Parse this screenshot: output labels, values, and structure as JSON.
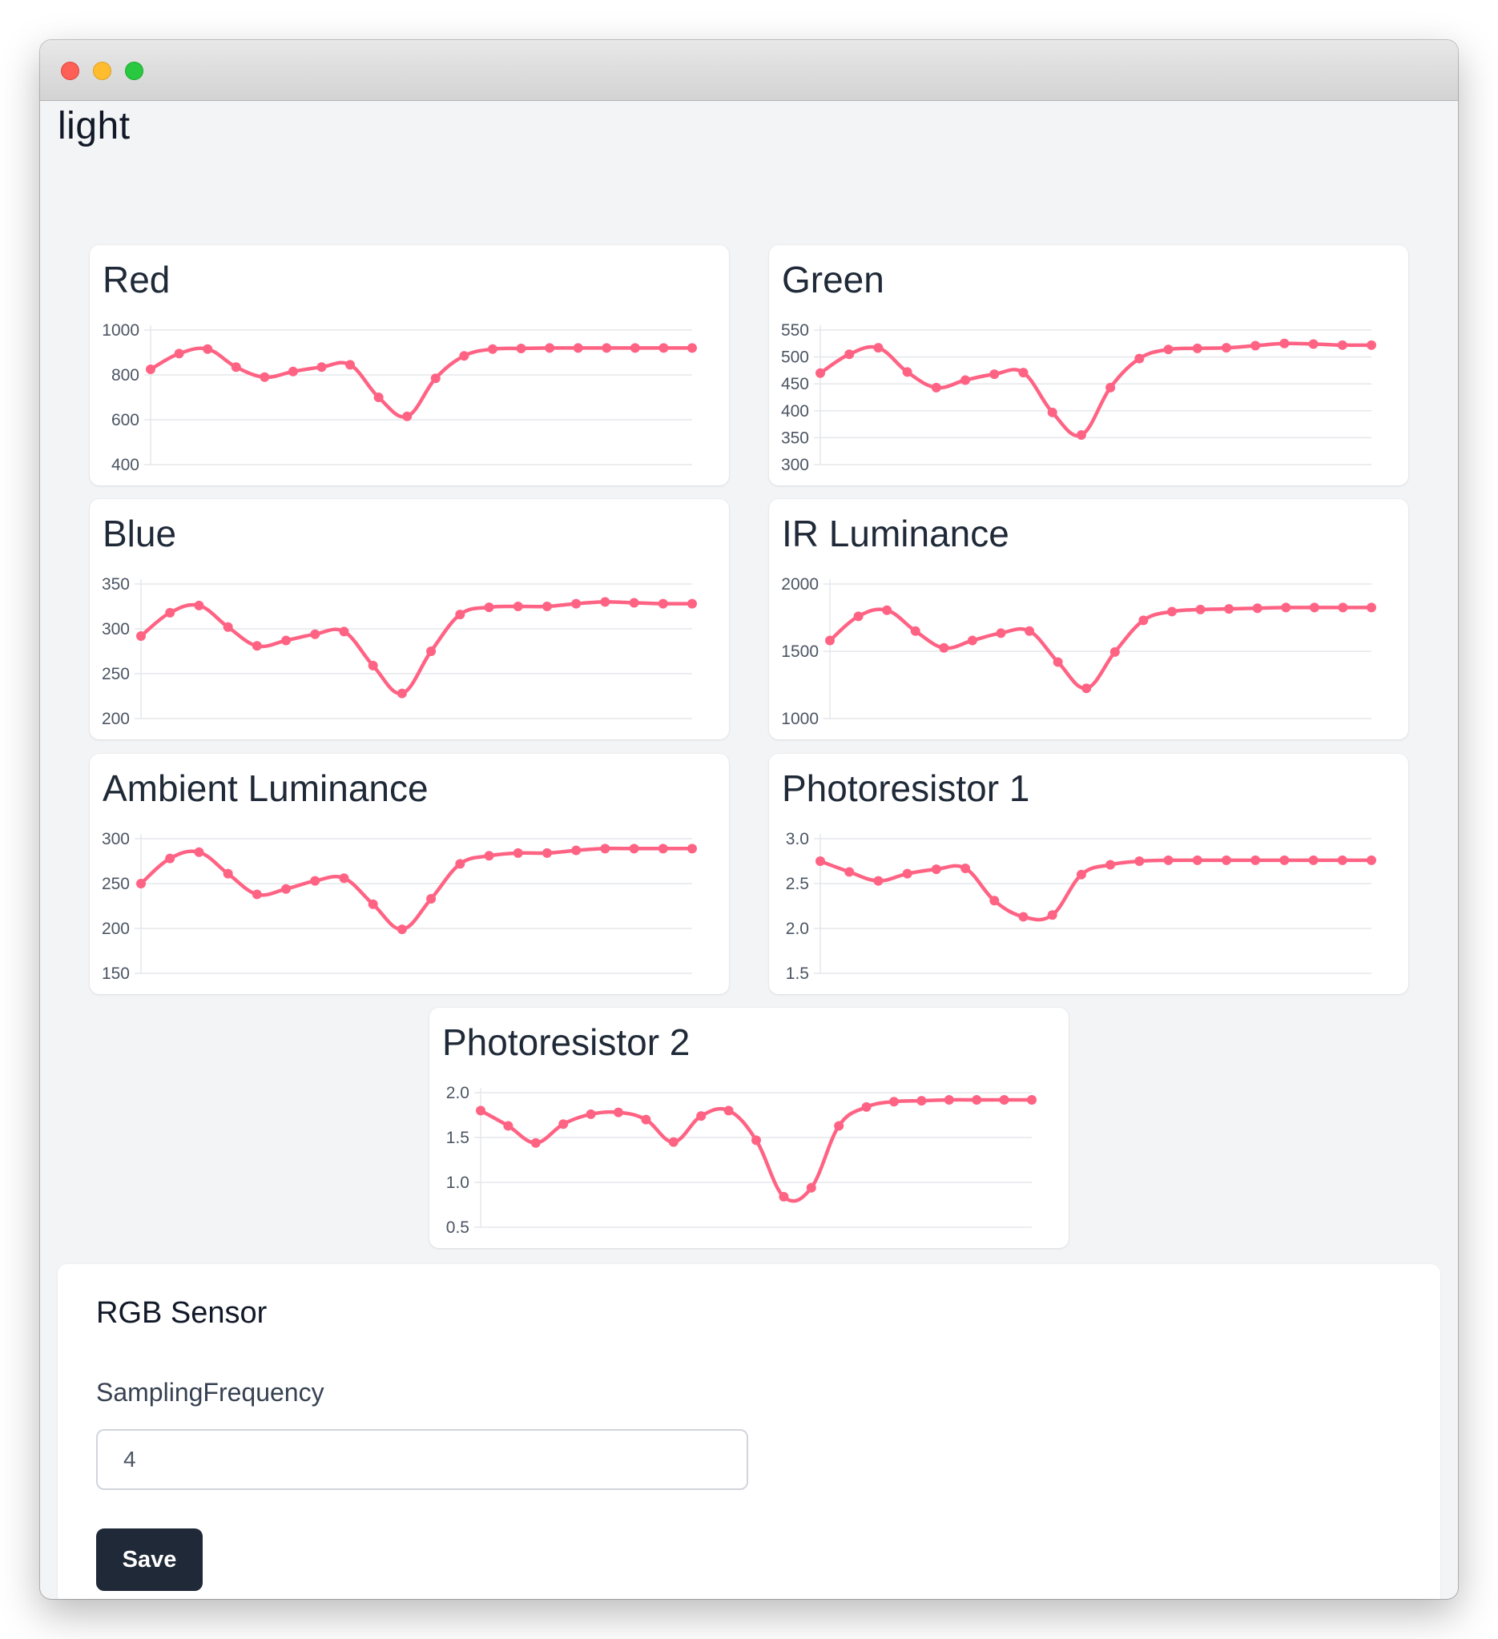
{
  "window": {
    "page_title": "light"
  },
  "line_color": "#ff6384",
  "charts": [
    {
      "id": "red",
      "title": "Red",
      "yticks": [
        "1000",
        "800",
        "600",
        "400"
      ]
    },
    {
      "id": "green",
      "title": "Green",
      "yticks": [
        "550",
        "500",
        "450",
        "400",
        "350",
        "300"
      ]
    },
    {
      "id": "blue",
      "title": "Blue",
      "yticks": [
        "350",
        "300",
        "250",
        "200"
      ]
    },
    {
      "id": "ir",
      "title": "IR Luminance",
      "yticks": [
        "2000",
        "1500",
        "1000"
      ]
    },
    {
      "id": "ambient",
      "title": "Ambient Luminance",
      "yticks": [
        "300",
        "250",
        "200",
        "150"
      ]
    },
    {
      "id": "pr1",
      "title": "Photoresistor 1",
      "yticks": [
        "3.0",
        "2.5",
        "2.0",
        "1.5"
      ]
    },
    {
      "id": "pr2",
      "title": "Photoresistor 2",
      "yticks": [
        "2.0",
        "1.5",
        "1.0",
        "0.5"
      ]
    }
  ],
  "chart_data": [
    {
      "type": "line",
      "title": "Red",
      "ylim": [
        400,
        1000
      ],
      "grid": true,
      "series": [
        {
          "values": [
            825,
            895,
            915,
            835,
            790,
            815,
            835,
            845,
            700,
            615,
            785,
            885,
            915,
            918,
            920,
            920,
            920,
            920,
            920,
            920
          ]
        }
      ]
    },
    {
      "type": "line",
      "title": "Green",
      "ylim": [
        300,
        550
      ],
      "grid": true,
      "series": [
        {
          "values": [
            470,
            505,
            517,
            472,
            443,
            457,
            468,
            471,
            397,
            355,
            443,
            497,
            514,
            516,
            517,
            521,
            525,
            524,
            522,
            522
          ]
        }
      ]
    },
    {
      "type": "line",
      "title": "Blue",
      "ylim": [
        200,
        350
      ],
      "grid": true,
      "series": [
        {
          "values": [
            292,
            318,
            326,
            302,
            281,
            287,
            294,
            297,
            259,
            228,
            275,
            316,
            324,
            325,
            325,
            328,
            330,
            329,
            328,
            328
          ]
        }
      ]
    },
    {
      "type": "line",
      "title": "IR Luminance",
      "ylim": [
        1000,
        2000
      ],
      "grid": true,
      "series": [
        {
          "values": [
            1580,
            1760,
            1805,
            1650,
            1525,
            1580,
            1635,
            1650,
            1420,
            1225,
            1495,
            1730,
            1795,
            1810,
            1815,
            1820,
            1825,
            1825,
            1825,
            1825
          ]
        }
      ]
    },
    {
      "type": "line",
      "title": "Ambient Luminance",
      "ylim": [
        150,
        300
      ],
      "grid": true,
      "series": [
        {
          "values": [
            250,
            278,
            285,
            261,
            238,
            244,
            253,
            256,
            227,
            199,
            233,
            272,
            281,
            284,
            284,
            287,
            289,
            289,
            289,
            289
          ]
        }
      ]
    },
    {
      "type": "line",
      "title": "Photoresistor 1",
      "ylim": [
        1.5,
        3.0
      ],
      "grid": true,
      "series": [
        {
          "values": [
            2.75,
            2.63,
            2.53,
            2.61,
            2.66,
            2.67,
            2.31,
            2.13,
            2.15,
            2.6,
            2.71,
            2.75,
            2.76,
            2.76,
            2.76,
            2.76,
            2.76,
            2.76,
            2.76,
            2.76
          ]
        }
      ]
    },
    {
      "type": "line",
      "title": "Photoresistor 2",
      "ylim": [
        0.5,
        2.0
      ],
      "grid": true,
      "series": [
        {
          "values": [
            1.8,
            1.63,
            1.44,
            1.65,
            1.76,
            1.78,
            1.7,
            1.45,
            1.74,
            1.8,
            1.47,
            0.84,
            0.94,
            1.63,
            1.84,
            1.9,
            1.91,
            1.92,
            1.92,
            1.92,
            1.92
          ]
        }
      ]
    }
  ],
  "settings": {
    "title": "RGB Sensor",
    "field_label": "SamplingFrequency",
    "field_value": "4",
    "save_label": "Save"
  }
}
